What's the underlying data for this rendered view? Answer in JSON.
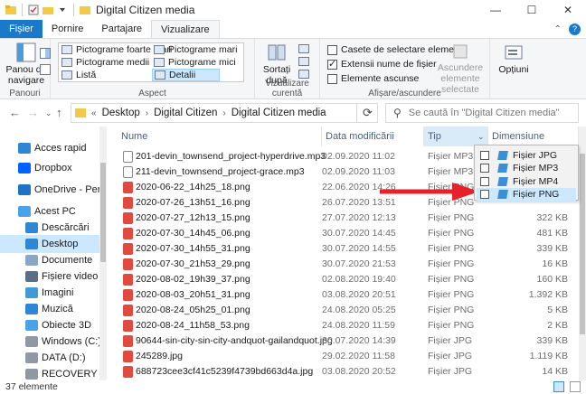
{
  "window": {
    "title": "Digital Citizen media",
    "minimize": "—",
    "maximize": "☐",
    "close": "✕"
  },
  "tabs": {
    "file": "Fișier",
    "home": "Pornire",
    "share": "Partajare",
    "view": "Vizualizare"
  },
  "ribbon": {
    "nav_pane": "Panou de\nnavigare",
    "panes_label": "Panouri",
    "layout": {
      "xl_icons": "Pictograme foarte mari",
      "large_icons": "Pictograme mari",
      "medium_icons": "Pictograme medii",
      "small_icons": "Pictograme mici",
      "list": "Listă",
      "details": "Detalii",
      "label": "Aspect"
    },
    "sort": "Sortați\ndupă",
    "current_view_label": "Vizualizare curentă",
    "show_hide": {
      "checkboxes": "Casete de selectare element",
      "extensions": "Extensii nume de fișier",
      "hidden": "Elemente ascunse",
      "hide_selected": "Ascundere\nelemente selectate",
      "label": "Afișare/ascundere"
    },
    "options": "Opțiuni"
  },
  "address": {
    "crumbs": [
      "Desktop",
      "Digital Citizen",
      "Digital Citizen media"
    ],
    "search_placeholder": "Se caută în \"Digital Citizen media\""
  },
  "nav": [
    {
      "label": "Acces rapid",
      "icon": "star-icon"
    },
    {
      "label": "Dropbox",
      "icon": "dropbox-icon"
    },
    {
      "label": "OneDrive - Person",
      "icon": "onedrive-icon"
    },
    {
      "label": "Acest PC",
      "icon": "pc-icon"
    },
    {
      "label": "Descărcări",
      "icon": "download-icon"
    },
    {
      "label": "Desktop",
      "icon": "desktop-icon",
      "selected": true
    },
    {
      "label": "Documente",
      "icon": "documents-icon"
    },
    {
      "label": "Fișiere video",
      "icon": "video-icon"
    },
    {
      "label": "Imagini",
      "icon": "images-icon"
    },
    {
      "label": "Muzică",
      "icon": "music-icon"
    },
    {
      "label": "Obiecte 3D",
      "icon": "3d-objects-icon"
    },
    {
      "label": "Windows (C:)",
      "icon": "drive-icon"
    },
    {
      "label": "DATA (D:)",
      "icon": "drive-icon"
    },
    {
      "label": "RECOVERY (F:)",
      "icon": "drive-icon"
    }
  ],
  "columns": {
    "name": "Nume",
    "date": "Data modificării",
    "type": "Tip",
    "size": "Dimensiune"
  },
  "files": [
    {
      "name": "201-devin_townsend_project-hyperdrive.mp3",
      "date": "02.09.2020 11:02",
      "type": "Fișier MP3",
      "size": "",
      "kind": "mp3"
    },
    {
      "name": "211-devin_townsend_project-grace.mp3",
      "date": "02.09.2020 11:03",
      "type": "Fișier MP3",
      "size": "",
      "kind": "mp3"
    },
    {
      "name": "2020-06-22_14h25_18.png",
      "date": "22.06.2020 14:26",
      "type": "Fișier PNG",
      "size": "",
      "kind": "png"
    },
    {
      "name": "2020-07-26_13h51_16.png",
      "date": "26.07.2020 13:51",
      "type": "Fișier PNG",
      "size": "",
      "kind": "png"
    },
    {
      "name": "2020-07-27_12h13_15.png",
      "date": "27.07.2020 12:13",
      "type": "Fișier PNG",
      "size": "322 KB",
      "kind": "png"
    },
    {
      "name": "2020-07-30_14h45_06.png",
      "date": "30.07.2020 14:45",
      "type": "Fișier PNG",
      "size": "481 KB",
      "kind": "png"
    },
    {
      "name": "2020-07-30_14h55_31.png",
      "date": "30.07.2020 14:55",
      "type": "Fișier PNG",
      "size": "339 KB",
      "kind": "png"
    },
    {
      "name": "2020-07-30_21h53_29.png",
      "date": "30.07.2020 21:53",
      "type": "Fișier PNG",
      "size": "16 KB",
      "kind": "png"
    },
    {
      "name": "2020-08-02_19h39_37.png",
      "date": "02.08.2020 19:40",
      "type": "Fișier PNG",
      "size": "160 KB",
      "kind": "png"
    },
    {
      "name": "2020-08-03_20h51_31.png",
      "date": "03.08.2020 20:51",
      "type": "Fișier PNG",
      "size": "1.392 KB",
      "kind": "png"
    },
    {
      "name": "2020-08-24_05h25_01.png",
      "date": "24.08.2020 05:25",
      "type": "Fișier PNG",
      "size": "5 KB",
      "kind": "png"
    },
    {
      "name": "2020-08-24_11h58_53.png",
      "date": "24.08.2020 11:59",
      "type": "Fișier PNG",
      "size": "2 KB",
      "kind": "png"
    },
    {
      "name": "90644-sin-city-sin-city-andquot-gailandquot.jpg",
      "date": "30.07.2020 14:39",
      "type": "Fișier JPG",
      "size": "339 KB",
      "kind": "jpg"
    },
    {
      "name": "245289.jpg",
      "date": "29.02.2020 11:58",
      "type": "Fișier JPG",
      "size": "1.119 KB",
      "kind": "jpg"
    },
    {
      "name": "688723cee3cf41c5239f4739bd663d4a.jpg",
      "date": "03.08.2020 20:52",
      "type": "Fișier JPG",
      "size": "14 KB",
      "kind": "jpg"
    }
  ],
  "filter_dropdown": [
    {
      "label": "Fișier JPG",
      "selected": false
    },
    {
      "label": "Fișier MP3",
      "selected": false
    },
    {
      "label": "Fișier MP4",
      "selected": false
    },
    {
      "label": "Fișier PNG",
      "selected": true
    }
  ],
  "status": {
    "count": "37 elemente"
  },
  "colors": {
    "accent": "#1979ca",
    "selection": "#cce8ff",
    "arrow": "#e8202a",
    "png_icon": "#e04a3f"
  }
}
